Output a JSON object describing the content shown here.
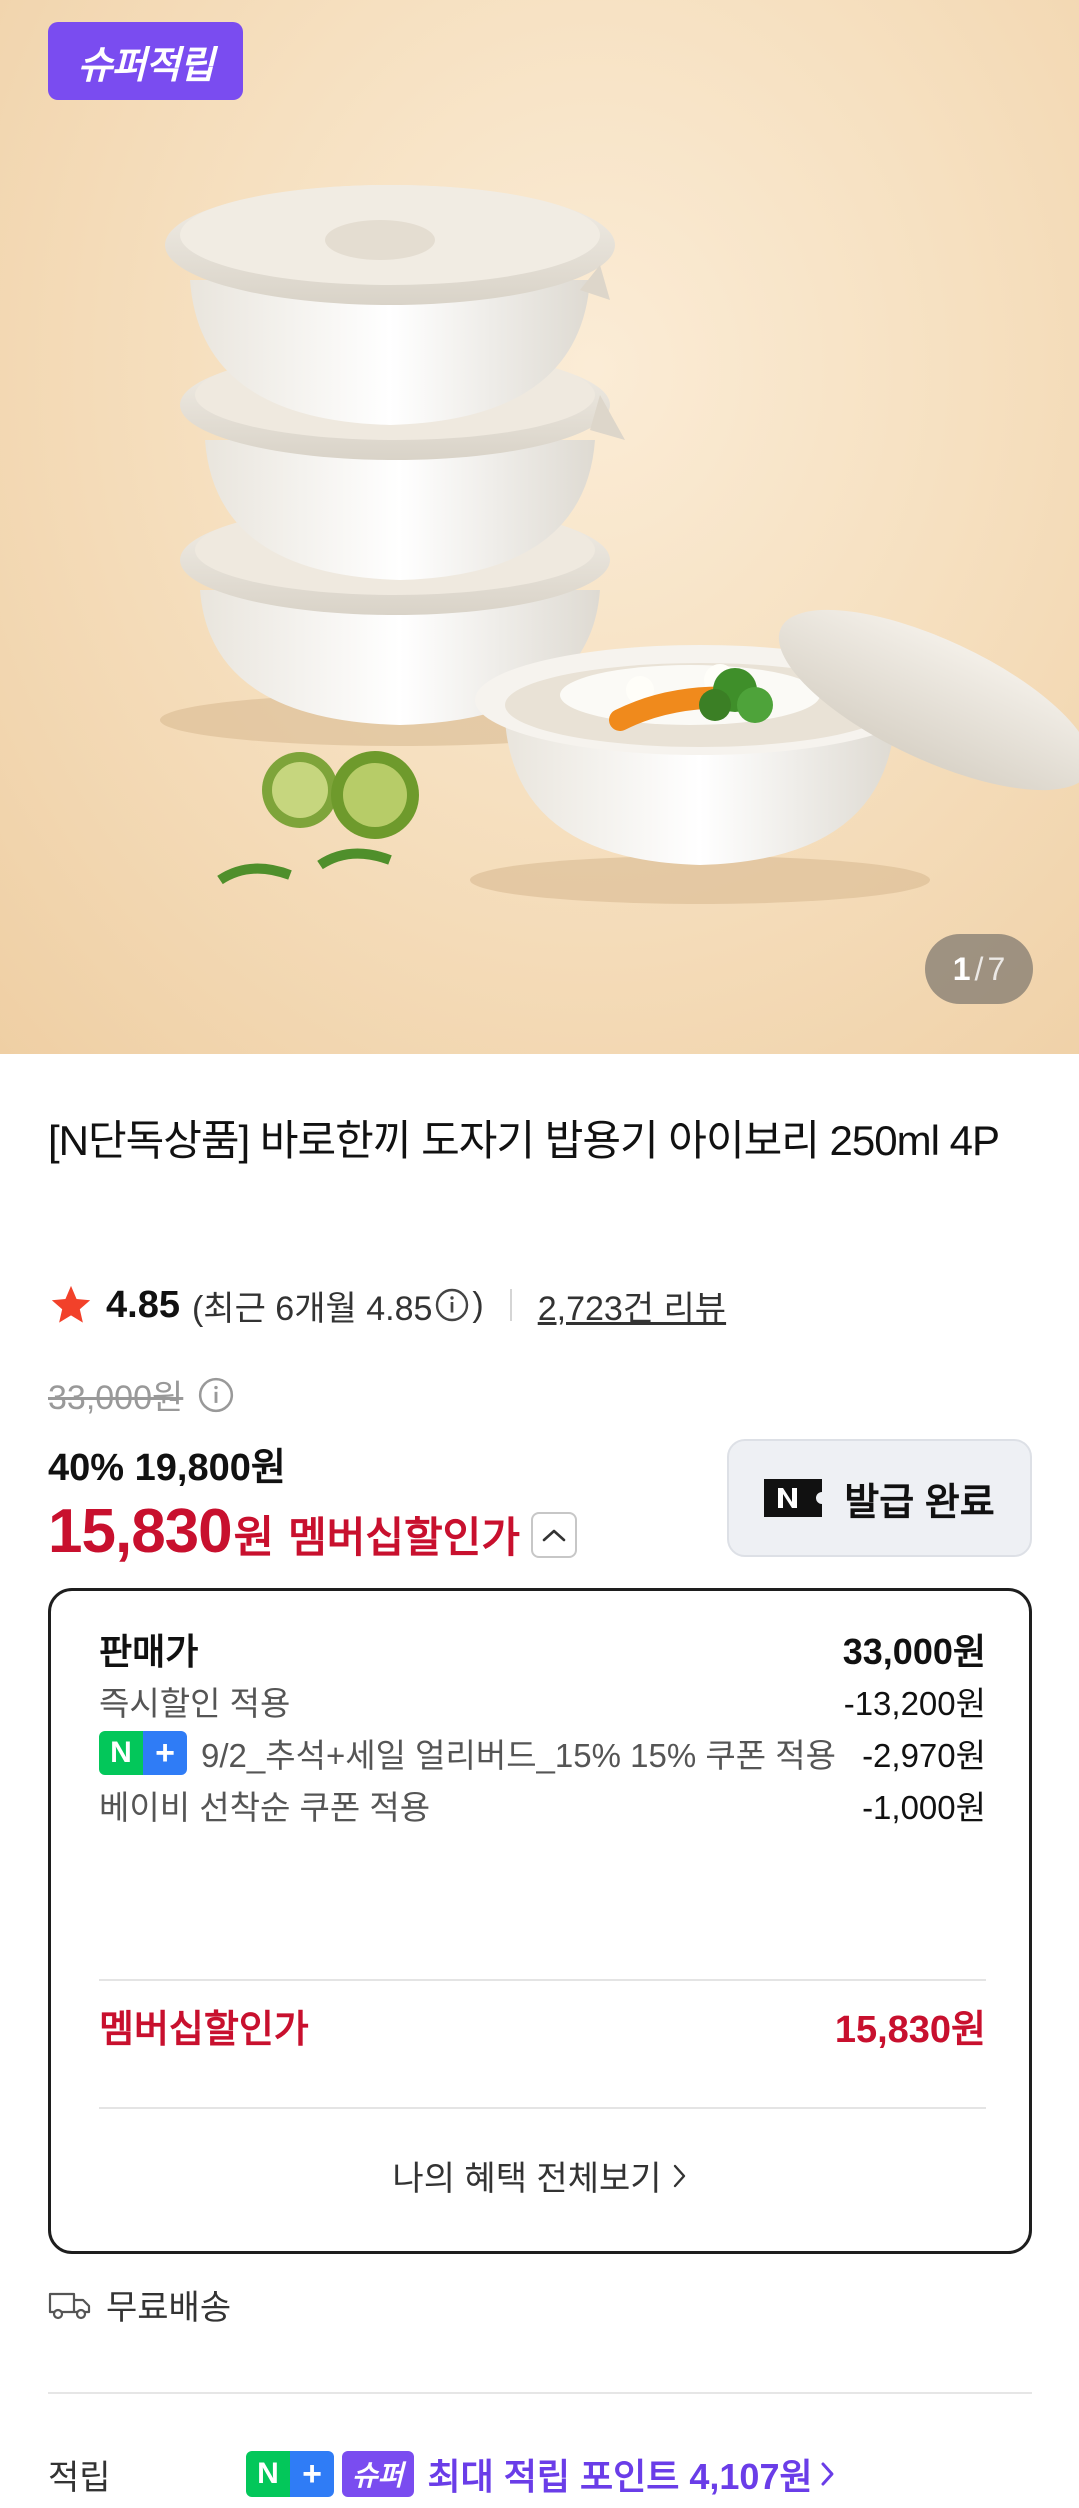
{
  "hero": {
    "badge_label": "슈퍼적립",
    "image_index": "1",
    "image_separator": "/",
    "image_total": "7"
  },
  "product": {
    "title": "[N단독상품] 바로한끼 도자기 밥용기 아이보리 250ml 4P"
  },
  "rating": {
    "score": "4.85",
    "recent_prefix": "(최근 6개월 4.85",
    "recent_suffix": ")",
    "reviews_label": "2,723건 리뷰"
  },
  "price": {
    "original": "33,000원",
    "sale_line": "40% 19,800원",
    "member_price": "15,830",
    "member_won": "원",
    "member_label": "멤버십할인가",
    "issued_button_label": "발급 완료"
  },
  "breakdown": {
    "rows": [
      {
        "label": "판매가",
        "value": "33,000원"
      },
      {
        "label": "즉시할인 적용",
        "value": "-13,200원"
      },
      {
        "label": "9/2_추석+세일 얼리버드_15% 15% 쿠폰 적용",
        "value": "-2,970원"
      },
      {
        "label": "베이비 선착순 쿠폰 적용",
        "value": "-1,000원"
      }
    ],
    "total_label": "멤버십할인가",
    "total_value": "15,830원",
    "more_label": "나의 혜택 전체보기"
  },
  "shipping": {
    "label": "무료배송"
  },
  "points": {
    "label": "적립",
    "super_badge": "슈퍼",
    "text": "최대 적립 포인트 4,107원"
  },
  "badges": {
    "n_label": "N",
    "plus_label": "+"
  },
  "colors": {
    "accent_red": "#c8102e",
    "super_purple": "#7a4cf0",
    "naver_green": "#03c75a",
    "plus_blue": "#2f7cf6"
  }
}
